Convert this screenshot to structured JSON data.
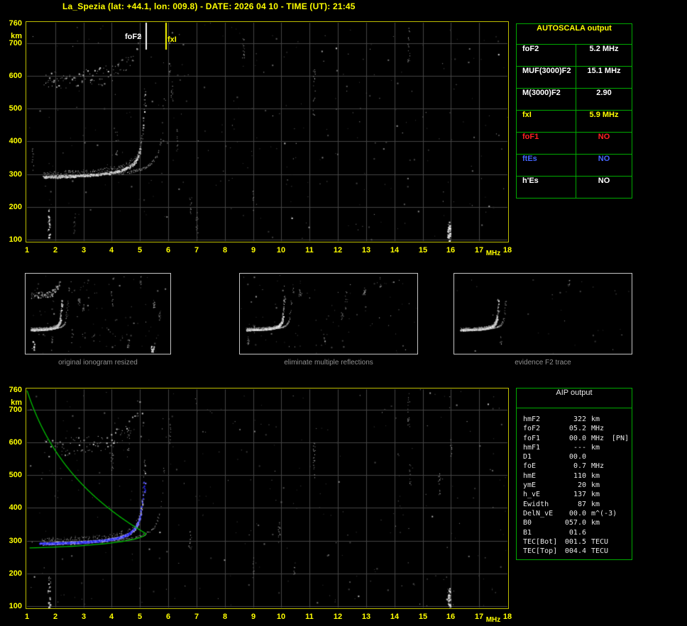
{
  "title": "La_Spezia (lat: +44.1, lon: 009.8) - DATE: 2026 04 10 - TIME (UT): 21:45",
  "colors": {
    "background": "#000000",
    "axis_text": "#ffff00",
    "plot_border": "#bcbc00",
    "table_border": "#00aa00",
    "thumb_border": "#c4c4c4",
    "caption_text": "#8f8f8f",
    "status_red": "#ff2222",
    "status_blue": "#4466ff",
    "status_yellow": "#ffff00",
    "profile_green": "#00c000",
    "fitted_trace_blue": "#4444ff"
  },
  "autoscala": {
    "title": "AUTOSCALA output",
    "rows": [
      {
        "label": "foF2",
        "value": "5.2 MHz",
        "color": "#ffffff"
      },
      {
        "label": "MUF(3000)F2",
        "value": "15.1 MHz",
        "color": "#ffffff"
      },
      {
        "label": "M(3000)F2",
        "value": "2.90",
        "color": "#ffffff"
      },
      {
        "label": "fxI",
        "value": "5.9 MHz",
        "color": "#ffff00"
      },
      {
        "label": "foF1",
        "value": "NO",
        "color": "#ff2222"
      },
      {
        "label": "ftEs",
        "value": "NO",
        "color": "#4466ff"
      },
      {
        "label": "h'Es",
        "value": "NO",
        "color": "#ffffff"
      }
    ]
  },
  "aip": {
    "title": "AIP output",
    "rows": [
      {
        "label": "hmF2",
        "value": "322",
        "unit": "km",
        "note": ""
      },
      {
        "label": "foF2",
        "value": "05.2",
        "unit": "MHz",
        "note": ""
      },
      {
        "label": "foF1",
        "value": "00.0",
        "unit": "MHz",
        "note": "[PN]"
      },
      {
        "label": "hmF1",
        "value": "---",
        "unit": "km",
        "note": ""
      },
      {
        "label": "D1",
        "value": "00.0",
        "unit": "",
        "note": ""
      },
      {
        "label": "foE",
        "value": "0.7",
        "unit": "MHz",
        "note": ""
      },
      {
        "label": "hmE",
        "value": "110",
        "unit": "km",
        "note": ""
      },
      {
        "label": "ymE",
        "value": "20",
        "unit": "km",
        "note": ""
      },
      {
        "label": "h_vE",
        "value": "137",
        "unit": "km",
        "note": ""
      },
      {
        "label": "Ewidth",
        "value": "87",
        "unit": "km",
        "note": ""
      },
      {
        "label": "DelN_vE",
        "value": "00.0",
        "unit": "m^(-3)",
        "note": ""
      },
      {
        "label": "B0",
        "value": "057.0",
        "unit": "km",
        "note": ""
      },
      {
        "label": "B1",
        "value": "01.6",
        "unit": "",
        "note": ""
      },
      {
        "label": "TEC[Bot]",
        "value": "001.5",
        "unit": "TECU",
        "note": ""
      },
      {
        "label": "TEC[Top]",
        "value": "004.4",
        "unit": "TECU",
        "note": ""
      }
    ]
  },
  "thumbnails": [
    {
      "caption": "original ionogram resized"
    },
    {
      "caption": "eliminate multiple reflections"
    },
    {
      "caption": "evidence F2 trace"
    }
  ],
  "chart_data": [
    {
      "id": "main-ionogram",
      "type": "scatter",
      "title": "scaled ionogram with AUTOSCALA markers",
      "xlabel": "MHz",
      "ylabel": "km",
      "xlim": [
        1,
        18
      ],
      "ylim": [
        100,
        760
      ],
      "xticks": [
        1,
        2,
        3,
        4,
        5,
        6,
        7,
        8,
        9,
        10,
        11,
        12,
        13,
        14,
        15,
        16,
        17,
        18
      ],
      "yticks": [
        760,
        700,
        600,
        500,
        400,
        300,
        200,
        100
      ],
      "grid": true,
      "markers": {
        "foF2_label": "foF2",
        "foF2_MHz": 5.2,
        "fxI_label": "fxI",
        "fxI_MHz": 5.9
      },
      "trace": {
        "min_virtual_height_km": 288,
        "o_mode_critical_MHz": 5.2,
        "x_mode_critical_MHz": 5.9,
        "multiple_reflections_visible": true
      }
    },
    {
      "id": "aip-ionogram",
      "type": "scatter",
      "title": "ionogram with AIP electron density profile",
      "xlabel": "MHz",
      "ylabel": "km",
      "xlim": [
        1,
        18
      ],
      "ylim": [
        100,
        760
      ],
      "xticks": [
        1,
        2,
        3,
        4,
        5,
        6,
        7,
        8,
        9,
        10,
        11,
        12,
        13,
        14,
        15,
        16,
        17,
        18
      ],
      "yticks": [
        760,
        700,
        600,
        500,
        400,
        300,
        200,
        100
      ],
      "grid": true,
      "profile": {
        "hmF2_km": 322,
        "foF2_MHz": 5.2,
        "topside_scale_height_km": 265,
        "bottomside_halfwidth_km": 45,
        "color": "#00c000"
      },
      "fitted_trace": {
        "foF2_MHz": 5.2,
        "color": "#4444ff"
      }
    }
  ]
}
